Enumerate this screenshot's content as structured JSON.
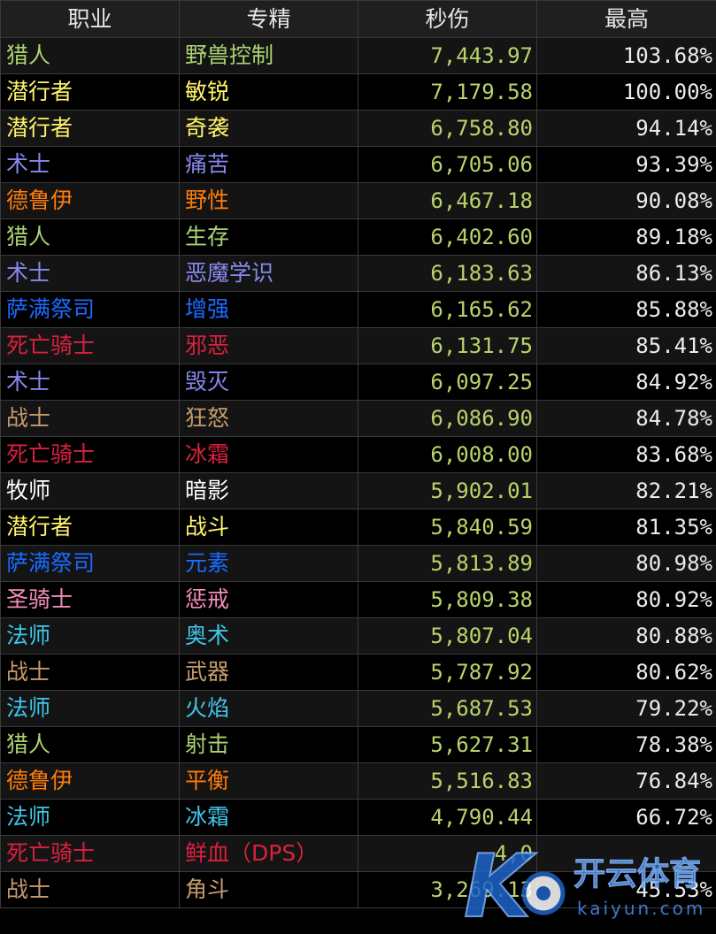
{
  "headers": [
    "职业",
    "专精",
    "秒伤",
    "最高"
  ],
  "class_colors": {
    "猎人": "#aad372",
    "潜行者": "#fff468",
    "术士": "#8788ee",
    "德鲁伊": "#ff7c0a",
    "萨满祭司": "#1a6bff",
    "死亡骑士": "#d9213f",
    "战士": "#c69b6d",
    "牧师": "#ffffff",
    "圣骑士": "#f48cba",
    "法师": "#3fc7eb"
  },
  "rows": [
    {
      "class": "猎人",
      "spec": "野兽控制",
      "dps": "7,443.97",
      "pct": "103.68%"
    },
    {
      "class": "潜行者",
      "spec": "敏锐",
      "dps": "7,179.58",
      "pct": "100.00%"
    },
    {
      "class": "潜行者",
      "spec": "奇袭",
      "dps": "6,758.80",
      "pct": "94.14%"
    },
    {
      "class": "术士",
      "spec": "痛苦",
      "dps": "6,705.06",
      "pct": "93.39%"
    },
    {
      "class": "德鲁伊",
      "spec": "野性",
      "dps": "6,467.18",
      "pct": "90.08%"
    },
    {
      "class": "猎人",
      "spec": "生存",
      "dps": "6,402.60",
      "pct": "89.18%"
    },
    {
      "class": "术士",
      "spec": "恶魔学识",
      "dps": "6,183.63",
      "pct": "86.13%"
    },
    {
      "class": "萨满祭司",
      "spec": "增强",
      "dps": "6,165.62",
      "pct": "85.88%"
    },
    {
      "class": "死亡骑士",
      "spec": "邪恶",
      "dps": "6,131.75",
      "pct": "85.41%"
    },
    {
      "class": "术士",
      "spec": "毁灭",
      "dps": "6,097.25",
      "pct": "84.92%"
    },
    {
      "class": "战士",
      "spec": "狂怒",
      "dps": "6,086.90",
      "pct": "84.78%"
    },
    {
      "class": "死亡骑士",
      "spec": "冰霜",
      "dps": "6,008.00",
      "pct": "83.68%"
    },
    {
      "class": "牧师",
      "spec": "暗影",
      "dps": "5,902.01",
      "pct": "82.21%"
    },
    {
      "class": "潜行者",
      "spec": "战斗",
      "dps": "5,840.59",
      "pct": "81.35%"
    },
    {
      "class": "萨满祭司",
      "spec": "元素",
      "dps": "5,813.89",
      "pct": "80.98%"
    },
    {
      "class": "圣骑士",
      "spec": "惩戒",
      "dps": "5,809.38",
      "pct": "80.92%"
    },
    {
      "class": "法师",
      "spec": "奥术",
      "dps": "5,807.04",
      "pct": "80.88%"
    },
    {
      "class": "战士",
      "spec": "武器",
      "dps": "5,787.92",
      "pct": "80.62%"
    },
    {
      "class": "法师",
      "spec": "火焰",
      "dps": "5,687.53",
      "pct": "79.22%"
    },
    {
      "class": "猎人",
      "spec": "射击",
      "dps": "5,627.31",
      "pct": "78.38%"
    },
    {
      "class": "德鲁伊",
      "spec": "平衡",
      "dps": "5,516.83",
      "pct": "76.84%"
    },
    {
      "class": "法师",
      "spec": "冰霜",
      "dps": "4,790.44",
      "pct": "66.72%"
    },
    {
      "class": "死亡骑士",
      "spec": "鲜血（DPS）",
      "dps": "4,0",
      "pct": ""
    },
    {
      "class": "战士",
      "spec": "角斗",
      "dps": "3,269.13",
      "pct": "45.53%"
    }
  ],
  "watermark": {
    "brand": "开云体育",
    "domain": "kaiyun.com",
    "logo_letter": "K",
    "colors": {
      "blue": "#1e63c9",
      "light": "#7fb6ff"
    }
  }
}
